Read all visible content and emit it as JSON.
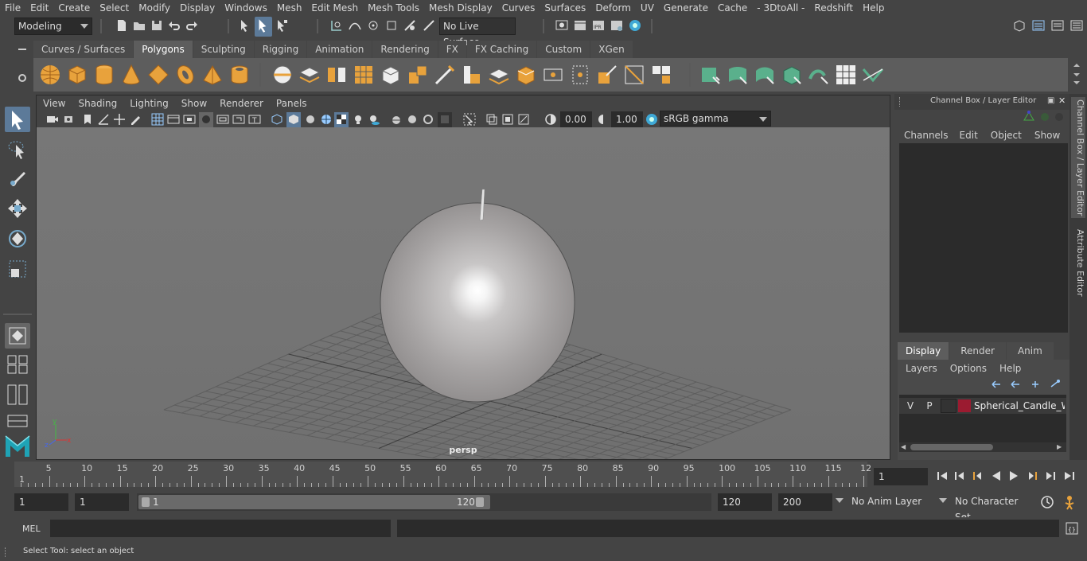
{
  "menubar": {
    "items": [
      "File",
      "Edit",
      "Create",
      "Select",
      "Modify",
      "Display",
      "Windows",
      "Mesh",
      "Edit Mesh",
      "Mesh Tools",
      "Mesh Display",
      "Curves",
      "Surfaces",
      "Deform",
      "UV",
      "Generate",
      "Cache",
      "- 3DtoAll -",
      "Redshift",
      "Help"
    ]
  },
  "statusline": {
    "mode": "Modeling",
    "live_surface": "No Live Surface"
  },
  "shelf": {
    "tabs": [
      "Curves / Surfaces",
      "Polygons",
      "Sculpting",
      "Rigging",
      "Animation",
      "Rendering",
      "FX",
      "FX Caching",
      "Custom",
      "XGen"
    ],
    "active_tab": "Polygons"
  },
  "viewport": {
    "menu": [
      "View",
      "Shading",
      "Lighting",
      "Show",
      "Renderer",
      "Panels"
    ],
    "exposure": "0.00",
    "gamma": "1.00",
    "color_space": "sRGB gamma",
    "camera": "persp"
  },
  "channelbox": {
    "title": "Channel Box / Layer Editor",
    "menu": [
      "Channels",
      "Edit",
      "Object",
      "Show"
    ],
    "layer_tabs": [
      "Display",
      "Render",
      "Anim"
    ],
    "active_layer_tab": "Display",
    "layer_menu": [
      "Layers",
      "Options",
      "Help"
    ],
    "layer": {
      "v": "V",
      "p": "P",
      "name": "Spherical_Candle_Whi",
      "color": "#9b1b30"
    },
    "side_tabs": [
      "Channel Box / Layer Editor",
      "Attribute Editor"
    ]
  },
  "timeslider": {
    "start_label": "1",
    "ticks": [
      "5",
      "10",
      "15",
      "20",
      "25",
      "30",
      "35",
      "40",
      "45",
      "50",
      "55",
      "60",
      "65",
      "70",
      "75",
      "80",
      "85",
      "90",
      "95",
      "100",
      "105",
      "110",
      "115",
      "12"
    ],
    "current_frame": "1"
  },
  "range": {
    "start": "1",
    "playback_start": "1",
    "slider_start": "1",
    "slider_end": "120",
    "playback_end": "120",
    "end": "200",
    "anim_layer": "No Anim Layer",
    "character_set": "No Character Set"
  },
  "mel": {
    "label": "MEL"
  },
  "help": {
    "text": "Select Tool: select an object"
  }
}
